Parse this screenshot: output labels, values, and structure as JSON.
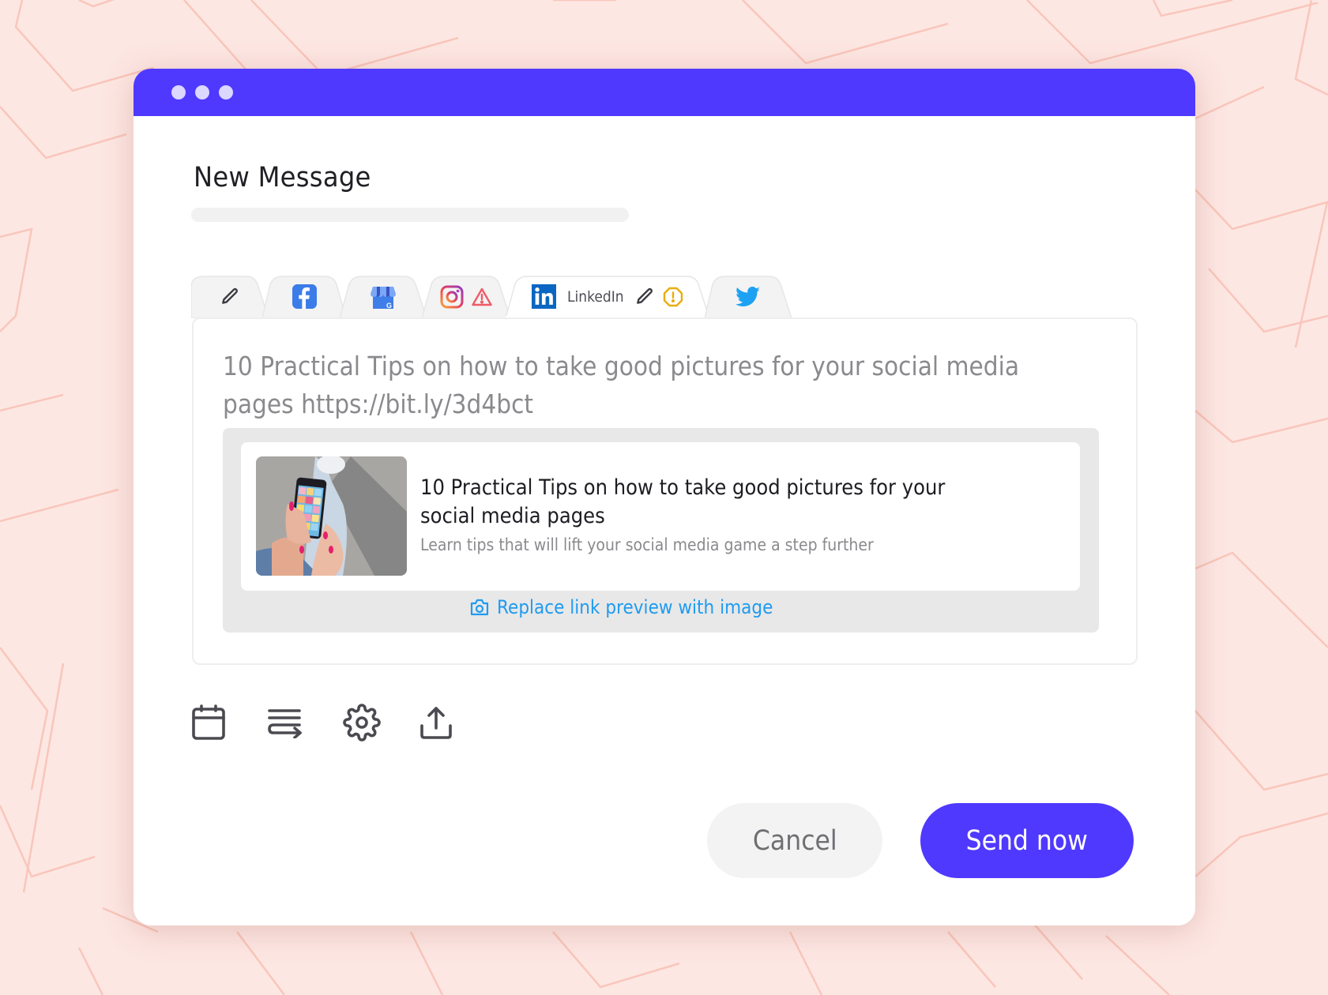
{
  "window": {
    "header_color": "#4f39fe",
    "dots": [
      "window-dot",
      "window-dot",
      "window-dot"
    ]
  },
  "page": {
    "title": "New Message",
    "subject_placeholder": ""
  },
  "tabs": [
    {
      "id": "all",
      "icon": "pencil-icon",
      "label": "",
      "active": false
    },
    {
      "id": "facebook",
      "icon": "facebook-icon",
      "label": "",
      "active": false
    },
    {
      "id": "google-business",
      "icon": "google-my-business-icon",
      "label": "",
      "active": false
    },
    {
      "id": "instagram",
      "icon": "instagram-icon",
      "label": "",
      "status_icon": "warning-triangle-icon",
      "active": false
    },
    {
      "id": "linkedin",
      "icon": "linkedin-icon",
      "label": "LinkedIn",
      "edit_icon": "pencil-icon",
      "status_icon": "alert-octagon-icon",
      "active": true
    },
    {
      "id": "twitter",
      "icon": "twitter-icon",
      "label": "",
      "active": false
    }
  ],
  "composer": {
    "text": "10 Practical Tips on how to take good pictures for your social media pages https://bit.ly/3d4bct",
    "preview": {
      "title": "10 Practical Tips on how to take good pictures for your social media pages",
      "description": "Learn tips that will lift your social media game a step further",
      "thumbnail": "person-holding-phone-photo",
      "replace_label": "Replace link preview with image",
      "replace_icon": "camera-icon"
    }
  },
  "toolbar": [
    {
      "icon": "calendar-icon",
      "action": "schedule"
    },
    {
      "icon": "text-wrap-icon",
      "action": "queue"
    },
    {
      "icon": "gear-icon",
      "action": "settings"
    },
    {
      "icon": "upload-icon",
      "action": "upload"
    }
  ],
  "actions": {
    "cancel_label": "Cancel",
    "send_label": "Send now"
  },
  "colors": {
    "accent": "#4f39fe",
    "link": "#1f9bf0",
    "background": "#fde7e3",
    "pattern_line": "#f9c6bb",
    "warning_red": "#f05a67",
    "alert_yellow": "#e9ad0c",
    "facebook": "#3b7ce8",
    "linkedin": "#0a66c2",
    "twitter": "#1da1f2"
  }
}
